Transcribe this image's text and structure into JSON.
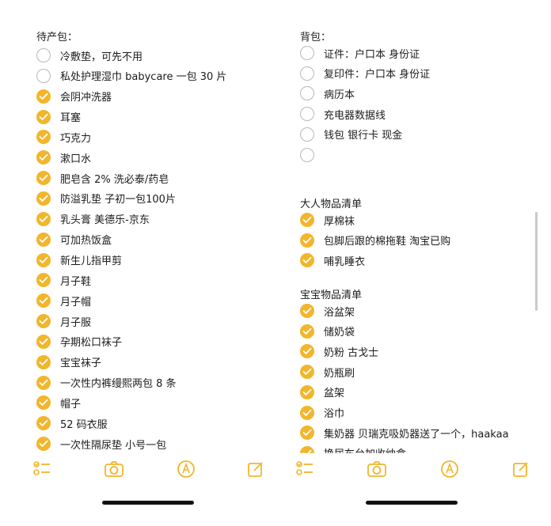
{
  "left": {
    "header": "待产包：",
    "items": [
      {
        "label": "冷敷垫，可先不用",
        "checked": false
      },
      {
        "label": "私处护理湿巾 babycare 一包 30 片",
        "checked": false
      },
      {
        "label": "会阴冲洗器",
        "checked": true
      },
      {
        "label": "耳塞",
        "checked": true
      },
      {
        "label": "巧克力",
        "checked": true
      },
      {
        "label": "漱口水",
        "checked": true
      },
      {
        "label": "肥皂含 2% 洗必泰/药皂",
        "checked": true
      },
      {
        "label": "防溢乳垫 子初一包100片",
        "checked": true
      },
      {
        "label": "乳头膏 美德乐-京东",
        "checked": true
      },
      {
        "label": "可加热饭盒",
        "checked": true
      },
      {
        "label": "新生儿指甲剪",
        "checked": true
      },
      {
        "label": "月子鞋",
        "checked": true
      },
      {
        "label": "月子帽",
        "checked": true
      },
      {
        "label": "月子服",
        "checked": true
      },
      {
        "label": "孕期松口袜子",
        "checked": true
      },
      {
        "label": "宝宝袜子",
        "checked": true
      },
      {
        "label": "一次性内裤缦熙两包 8 条",
        "checked": true
      },
      {
        "label": "帽子",
        "checked": true
      },
      {
        "label": "52 码衣服",
        "checked": true
      },
      {
        "label": "一次性隔尿垫 小号一包",
        "checked": true
      }
    ]
  },
  "right": {
    "sections": [
      {
        "header": "背包：",
        "items": [
          {
            "label": "证件：户口本 身份证",
            "checked": false
          },
          {
            "label": "复印件：户口本 身份证",
            "checked": false
          },
          {
            "label": "病历本",
            "checked": false
          },
          {
            "label": "充电器数据线",
            "checked": false
          },
          {
            "label": "钱包 银行卡 现金",
            "checked": false
          },
          {
            "label": "",
            "checked": false
          }
        ]
      },
      {
        "header": "大人物品清单",
        "items": [
          {
            "label": "厚棉袜",
            "checked": true
          },
          {
            "label": "包脚后跟的棉拖鞋 淘宝已购",
            "checked": true
          },
          {
            "label": "哺乳睡衣",
            "checked": true
          }
        ]
      },
      {
        "header": "宝宝物品清单",
        "items": [
          {
            "label": "浴盆架",
            "checked": true
          },
          {
            "label": "储奶袋",
            "checked": true
          },
          {
            "label": "奶粉 古戈士",
            "checked": true
          },
          {
            "label": "奶瓶刷",
            "checked": true
          },
          {
            "label": "盆架",
            "checked": true
          },
          {
            "label": "浴巾",
            "checked": true
          },
          {
            "label": "集奶器 贝瑞克吸奶器送了一个，haakaa",
            "checked": true
          },
          {
            "label": "换尿布台加收纳盒",
            "checked": true
          }
        ]
      }
    ]
  },
  "toolbar": {
    "icons": [
      "checklist-icon",
      "camera-icon",
      "markup-pen-icon",
      "compose-icon"
    ],
    "accent": "#f2b62c"
  },
  "colors": {
    "check_fill": "#f2b62c",
    "unchecked_border": "#b8b8bd"
  }
}
